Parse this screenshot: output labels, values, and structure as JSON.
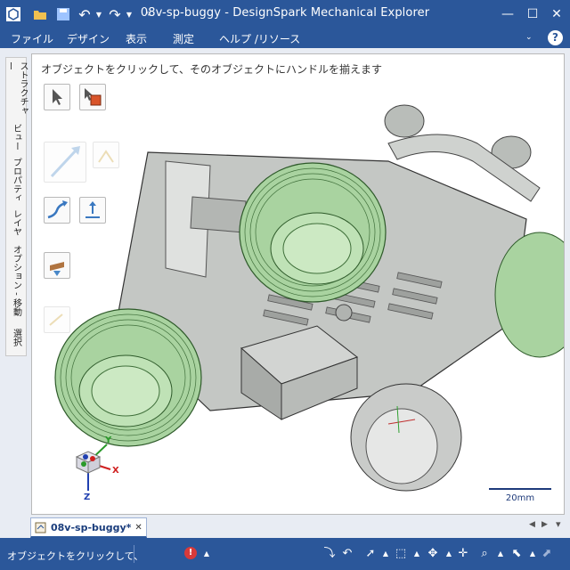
{
  "window": {
    "title": "08v-sp-buggy - DesignSpark Mechanical Explorer"
  },
  "menu": [
    "ファイル",
    "デザイン",
    "表示",
    "測定",
    "ヘルプ /リソース"
  ],
  "side_tabs": [
    "ストラクチャー",
    "ビュー",
    "プロパティ",
    "レイヤ",
    "オプション - 移動",
    "選択"
  ],
  "viewport": {
    "hint": "オブジェクトをクリックして、そのオブジェクトにハンドルを揃えます",
    "scale_label": "20mm",
    "triad": {
      "x": "X",
      "y": "Y",
      "z": "Z"
    }
  },
  "document_tab": {
    "label": "08v-sp-buggy*",
    "close": "✕"
  },
  "status": {
    "text": "オブジェクトをクリックして、"
  },
  "colors": {
    "accent": "#2b579a",
    "tire": "#a9d3a0",
    "body": "#c8cac8"
  }
}
